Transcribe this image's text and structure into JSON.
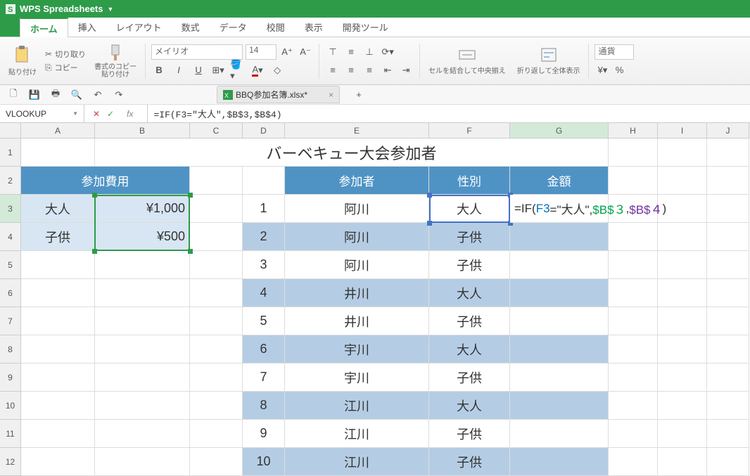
{
  "app": {
    "name": "WPS Spreadsheets"
  },
  "menu": {
    "tabs": [
      "ホーム",
      "挿入",
      "レイアウト",
      "数式",
      "データ",
      "校閲",
      "表示",
      "開発ツール"
    ]
  },
  "ribbon": {
    "paste": "貼り付け",
    "cut": "切り取り",
    "copy": "コピー",
    "format_copy": "書式のコピー\n貼り付け",
    "font": "メイリオ",
    "size": "14",
    "merge": "セルを結合して中央揃え",
    "wrap": "折り返して全体表示",
    "numfmt": "通貨"
  },
  "file": {
    "name": "BBQ参加名簿.xlsx*"
  },
  "namebox": "VLOOKUP",
  "formula": "=IF(F3=\"大人\",$B$3,$B$4)",
  "columns": [
    "A",
    "B",
    "C",
    "D",
    "E",
    "F",
    "G",
    "H",
    "I",
    "J"
  ],
  "rownums": [
    "1",
    "2",
    "3",
    "4",
    "5",
    "6",
    "7",
    "8",
    "9",
    "10",
    "11",
    "12"
  ],
  "sheet": {
    "title": "バーベキュー大会参加者",
    "fee_header": "参加費用",
    "adult": "大人",
    "child": "子供",
    "fee_adult": "¥1,000",
    "fee_child": "¥500",
    "part_header": "参加者",
    "type_header": "性別",
    "amt_header": "金額",
    "formula_disp": {
      "pre": "=IF(",
      "ref0": "F3",
      "mid1": "=\"大人\",",
      "ref1": "$B$３",
      "mid2": ",",
      "ref2": "$B$４",
      "post": ")"
    },
    "rows": [
      {
        "n": "1",
        "name": "阿川",
        "t": "大人"
      },
      {
        "n": "2",
        "name": "阿川",
        "t": "子供"
      },
      {
        "n": "3",
        "name": "阿川",
        "t": "子供"
      },
      {
        "n": "4",
        "name": "井川",
        "t": "大人"
      },
      {
        "n": "5",
        "name": "井川",
        "t": "子供"
      },
      {
        "n": "6",
        "name": "宇川",
        "t": "大人"
      },
      {
        "n": "7",
        "name": "宇川",
        "t": "子供"
      },
      {
        "n": "8",
        "name": "江川",
        "t": "大人"
      },
      {
        "n": "9",
        "name": "江川",
        "t": "子供"
      },
      {
        "n": "10",
        "name": "江川",
        "t": "子供"
      }
    ]
  }
}
